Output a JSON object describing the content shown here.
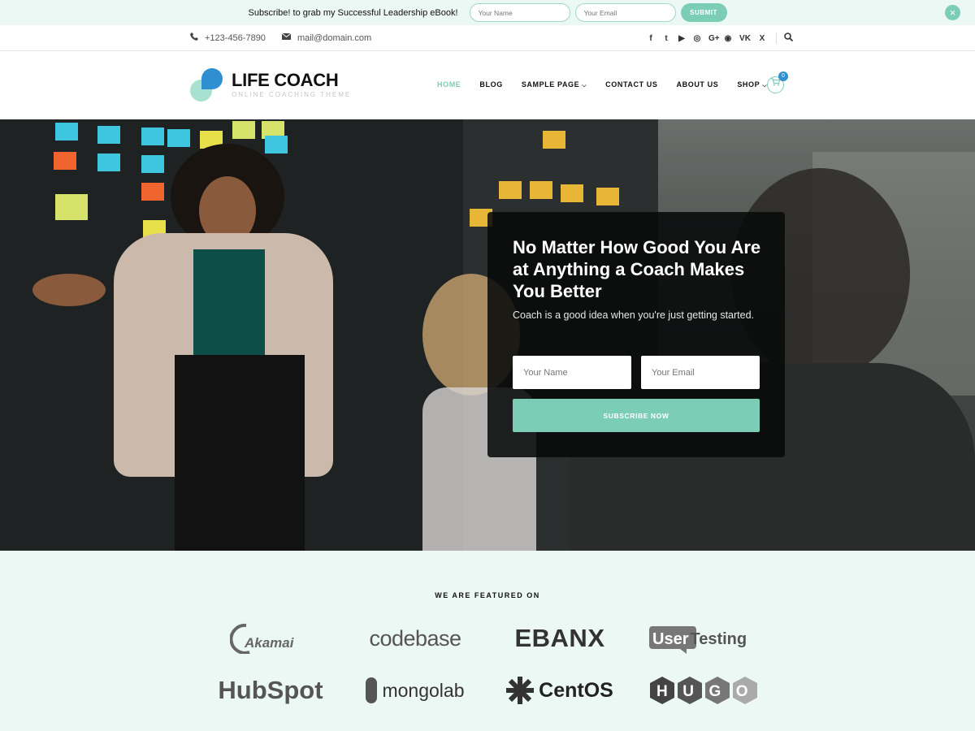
{
  "notice": {
    "text": "Subscribe! to grab my Successful Leadership eBook!",
    "name_placeholder": "Your Name",
    "email_placeholder": "Your Email",
    "submit_label": "SUBMIT",
    "close_icon": "×"
  },
  "topbar": {
    "phone_icon": "phone-icon",
    "phone": "+123-456-7890",
    "mail_icon": "mail-icon",
    "email": "mail@domain.com",
    "social": [
      "f",
      "t",
      "▶",
      "◎",
      "G+",
      "◉",
      "VK",
      "X"
    ],
    "search_icon": "⌕"
  },
  "header": {
    "logo_name": "LIFE COACH",
    "logo_tagline": "ONLINE COACHING THEME",
    "nav": [
      {
        "label": "HOME",
        "active": true
      },
      {
        "label": "BLOG"
      },
      {
        "label": "SAMPLE PAGE",
        "caret": true
      },
      {
        "label": "CONTACT US"
      },
      {
        "label": "ABOUT US"
      },
      {
        "label": "SHOP",
        "caret": true
      }
    ],
    "cart_count": "0",
    "accent": "#7ccdb5",
    "brand_blue": "#2f8fd0"
  },
  "hero": {
    "title": "No Matter How Good You Are at Anything a Coach Makes You Better",
    "subtitle": "Coach is a good idea when you're just getting started.",
    "name_placeholder": "Your Name",
    "email_placeholder": "Your Email",
    "button": "SUBSCRIBE NOW"
  },
  "featured": {
    "title": "WE ARE FEATURED ON",
    "brands": [
      "Akamai",
      "codebase",
      "EBANX",
      "UserTesting",
      "HubSpot",
      "mongolab",
      "CentOS",
      "HUGO"
    ]
  }
}
